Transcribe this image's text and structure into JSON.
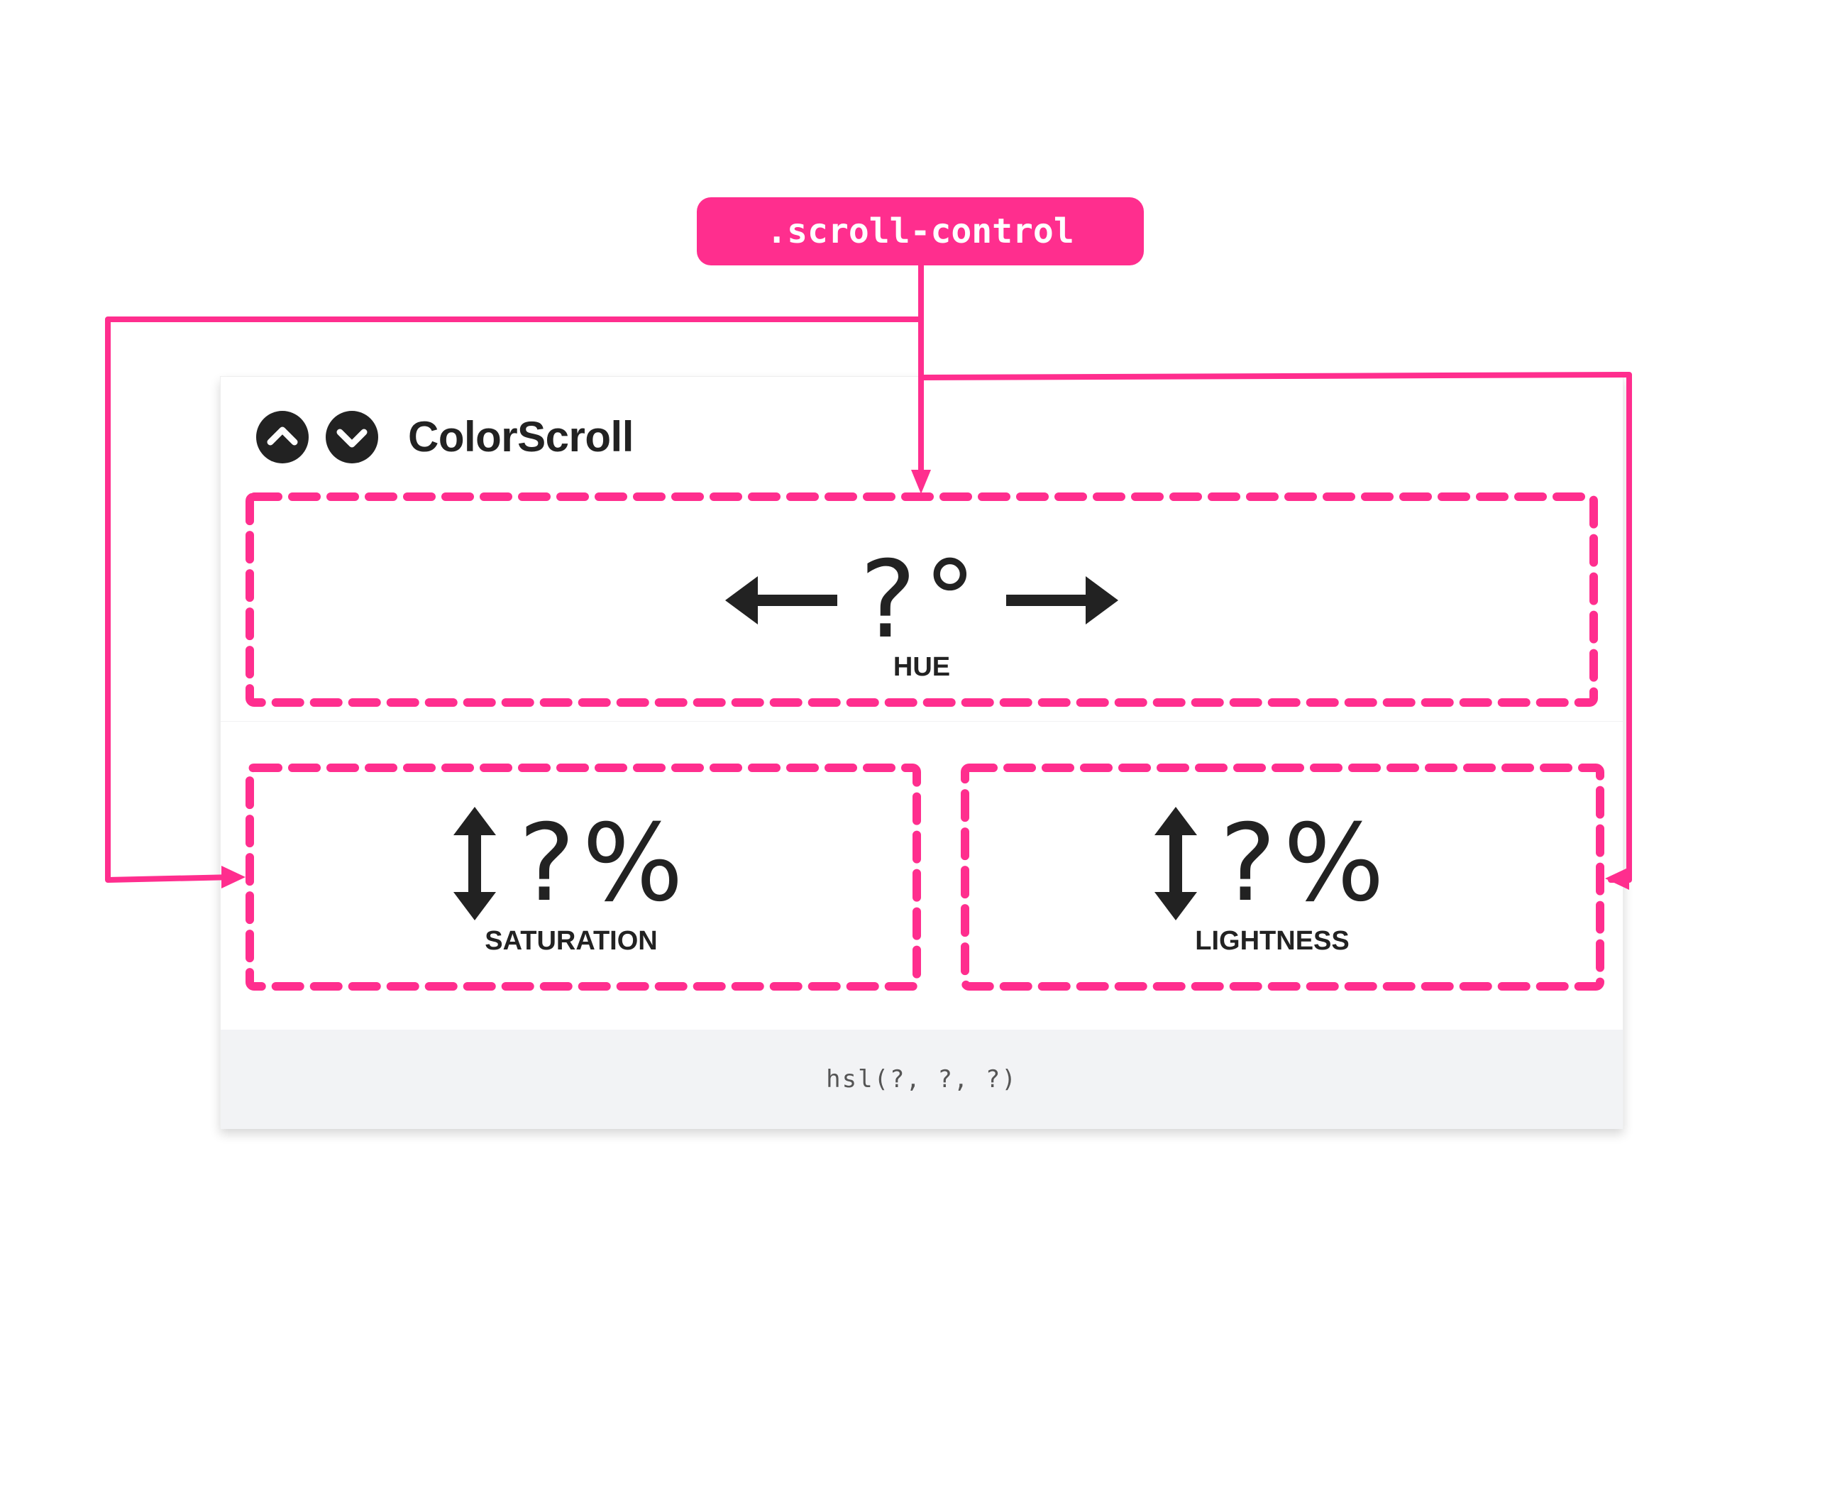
{
  "annotation": {
    "tag_label": ".scroll-control",
    "accent_color": "#ff2e8e"
  },
  "app": {
    "title": "ColorScroll",
    "buttons": {
      "up_icon": "chevron-up-circle-icon",
      "down_icon": "chevron-down-circle-icon"
    }
  },
  "controls": {
    "hue": {
      "value": "?°",
      "label": "HUE",
      "left_icon": "arrow-left-icon",
      "right_icon": "arrow-right-icon"
    },
    "saturation": {
      "value": "?%",
      "label": "SATURATION",
      "icon": "arrow-up-down-icon"
    },
    "lightness": {
      "value": "?%",
      "label": "LIGHTNESS",
      "icon": "arrow-up-down-icon"
    }
  },
  "footer": {
    "color_value": "hsl(?, ?, ?)"
  }
}
